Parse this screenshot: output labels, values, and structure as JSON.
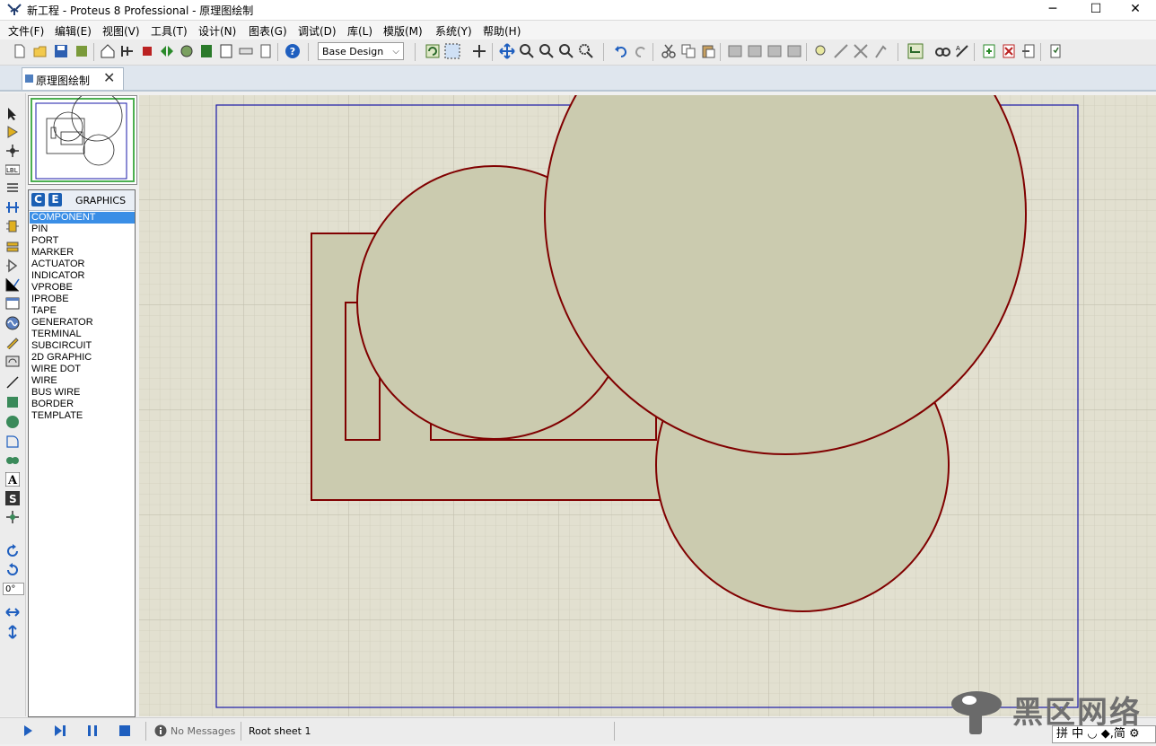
{
  "window": {
    "title": "新工程 - Proteus 8 Professional - 原理图绘制",
    "min_glyph": "─",
    "max_glyph": "☐",
    "close_glyph": "✕"
  },
  "menu": [
    "文件(F)",
    "编辑(E)",
    "视图(V)",
    "工具(T)",
    "设计(N)",
    "图表(G)",
    "调试(D)",
    "库(L)",
    "模版(M)",
    "系统(Y)",
    "帮助(H)"
  ],
  "toolbar": {
    "design_select_value": "Base Design"
  },
  "tabs": [
    {
      "label": "原理图绘制",
      "close": "✕"
    }
  ],
  "object_panel": {
    "btn_c": "C",
    "btn_e": "E",
    "mode_label": "GRAPHICS",
    "items": [
      "COMPONENT",
      "PIN",
      "PORT",
      "MARKER",
      "ACTUATOR",
      "INDICATOR",
      "VPROBE",
      "IPROBE",
      "TAPE",
      "GENERATOR",
      "TERMINAL",
      "SUBCIRCUIT",
      "2D GRAPHIC",
      "WIRE DOT",
      "WIRE",
      "BUS WIRE",
      "BORDER",
      "TEMPLATE"
    ],
    "selected": "COMPONENT"
  },
  "rotation": {
    "value": "0°"
  },
  "status": {
    "messages": "No Messages",
    "sheet": "Root sheet 1"
  },
  "overlay": {
    "logo_text": "黑区网络",
    "ime_text": "拼 中 ◡ ◆,简 ⚙"
  },
  "colors": {
    "canvas_bg": "#e2e0d0",
    "shape_fill": "#cbcbaf",
    "shape_stroke": "#800000",
    "sheet_border": "#1a1aa8",
    "selection_blue": "#3a8ee6"
  }
}
